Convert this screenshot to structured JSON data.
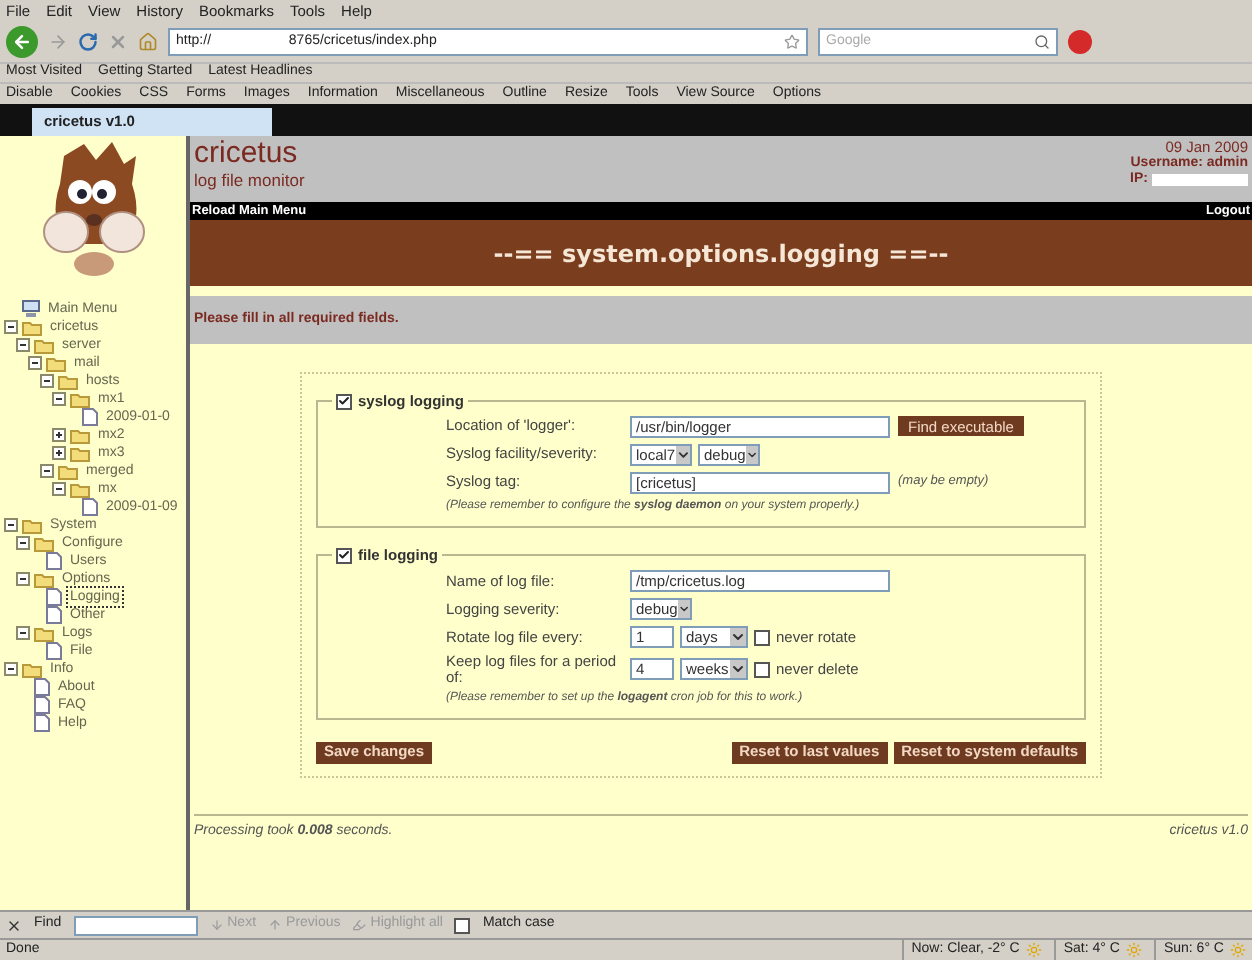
{
  "menu_bar": [
    "File",
    "Edit",
    "View",
    "History",
    "Bookmarks",
    "Tools",
    "Help"
  ],
  "nav_toolbar": {
    "url": "http://                    8765/cricetus/index.php",
    "search_placeholder": "Google"
  },
  "bookmarks": [
    "Most Visited",
    "Getting Started",
    "Latest Headlines"
  ],
  "developer_toolbar": [
    "Disable",
    "Cookies",
    "CSS",
    "Forms",
    "Images",
    "Information",
    "Miscellaneous",
    "Outline",
    "Resize",
    "Tools",
    "View Source",
    "Options"
  ],
  "tabs": [
    {
      "label": "cricetus v1.0",
      "selected": true
    }
  ],
  "sidebar": {
    "tree": [
      {
        "label": "Main Menu",
        "kind": "root",
        "selected": false
      },
      {
        "label": "cricetus",
        "kind": "folder",
        "expanded": true,
        "selected": false,
        "children": [
          {
            "label": "server",
            "kind": "folder",
            "expanded": true,
            "selected": false,
            "children": [
              {
                "label": "mail",
                "kind": "folder",
                "expanded": true,
                "selected": false,
                "children": [
                  {
                    "label": "hosts",
                    "kind": "folder",
                    "expanded": true,
                    "selected": false,
                    "children": [
                      {
                        "label": "mx1",
                        "kind": "folder",
                        "expanded": true,
                        "selected": false,
                        "children": [
                          {
                            "label": "2009-01-0",
                            "kind": "page",
                            "selected": false
                          }
                        ]
                      },
                      {
                        "label": "mx2",
                        "kind": "folder",
                        "expanded": false,
                        "selected": false
                      },
                      {
                        "label": "mx3",
                        "kind": "folder",
                        "expanded": false,
                        "selected": false
                      }
                    ]
                  },
                  {
                    "label": "merged",
                    "kind": "folder",
                    "expanded": true,
                    "selected": false,
                    "children": [
                      {
                        "label": "mx",
                        "kind": "folder",
                        "expanded": true,
                        "selected": false,
                        "children": [
                          {
                            "label": "2009-01-09",
                            "kind": "page",
                            "selected": false
                          }
                        ]
                      }
                    ]
                  }
                ]
              }
            ]
          }
        ]
      },
      {
        "label": "System",
        "kind": "folder",
        "expanded": true,
        "selected": false,
        "children": [
          {
            "label": "Configure",
            "kind": "folder",
            "expanded": true,
            "selected": false,
            "children": [
              {
                "label": "Users",
                "kind": "page",
                "selected": false
              }
            ]
          },
          {
            "label": "Options",
            "kind": "folder",
            "expanded": true,
            "selected": false,
            "children": [
              {
                "label": "Logging",
                "kind": "page",
                "selected": true
              },
              {
                "label": "Other",
                "kind": "page",
                "selected": false
              }
            ]
          },
          {
            "label": "Logs",
            "kind": "folder",
            "expanded": true,
            "selected": false,
            "children": [
              {
                "label": "File",
                "kind": "page",
                "selected": false
              }
            ]
          }
        ]
      },
      {
        "label": "Info",
        "kind": "folder",
        "expanded": true,
        "selected": false,
        "children": [
          {
            "label": "About",
            "kind": "page",
            "selected": false
          },
          {
            "label": "FAQ",
            "kind": "page",
            "selected": false
          },
          {
            "label": "Help",
            "kind": "page",
            "selected": false
          }
        ]
      }
    ]
  },
  "header": {
    "title": "cricetus",
    "subtitle": "log file monitor",
    "date": "09 Jan 2009",
    "username": "Username: admin",
    "ip_label": "IP:"
  },
  "nav_bar": {
    "left": "Reload Main Menu",
    "right": "Logout"
  },
  "page_title": "--== system.options.logging ==--",
  "message": "Please fill in all required fields.",
  "sections": [
    {
      "label": "syslog logging",
      "checked": true,
      "fields": [
        {
          "kind": "text",
          "label": "Location of 'logger':",
          "value": "/usr/bin/logger",
          "button": "Find executable"
        },
        {
          "kind": "selects",
          "label": "Syslog facility/severity:",
          "selects": [
            "local7",
            "debug"
          ]
        },
        {
          "kind": "text",
          "label": "Syslog tag:",
          "value": "[cricetus]",
          "hint": "(may be empty)"
        }
      ],
      "note": "(Please remember to configure the **syslog daemon** on your system properly.)"
    },
    {
      "label": "file logging",
      "checked": true,
      "fields": [
        {
          "kind": "text",
          "label": "Name of log file:",
          "value": "/tmp/cricetus.log"
        },
        {
          "kind": "selects",
          "label": "Logging severity:",
          "selects": [
            "debug"
          ]
        },
        {
          "kind": "period",
          "label": "Rotate log file every:",
          "value": "1",
          "unit": "days",
          "option": {
            "label": "never rotate",
            "checked": false
          }
        },
        {
          "kind": "period",
          "label": "Keep log files for a period of:",
          "value": "4",
          "unit": "weeks",
          "option": {
            "label": "never delete",
            "checked": false
          }
        }
      ],
      "note": "(Please remember to set up the **logagent** cron job for this to work.)"
    }
  ],
  "buttons": {
    "save": "Save changes",
    "reset": [
      "Reset to last values",
      "Reset to system defaults"
    ]
  },
  "footer": {
    "timing": "Processing took **0.008** seconds.",
    "version": "cricetus v1.0"
  },
  "find_bar": {
    "label": "Find",
    "items": [
      {
        "label": "Next",
        "disabled": true
      },
      {
        "label": "Previous",
        "disabled": true
      },
      {
        "label": "Highlight all",
        "disabled": true
      }
    ],
    "match_case": {
      "label": "Match case",
      "checked": false
    }
  },
  "status_bar": {
    "status": "Done",
    "weather": [
      "Now: Clear, -2° C",
      "Sat: 4° C",
      "Sun: 6° C"
    ]
  }
}
